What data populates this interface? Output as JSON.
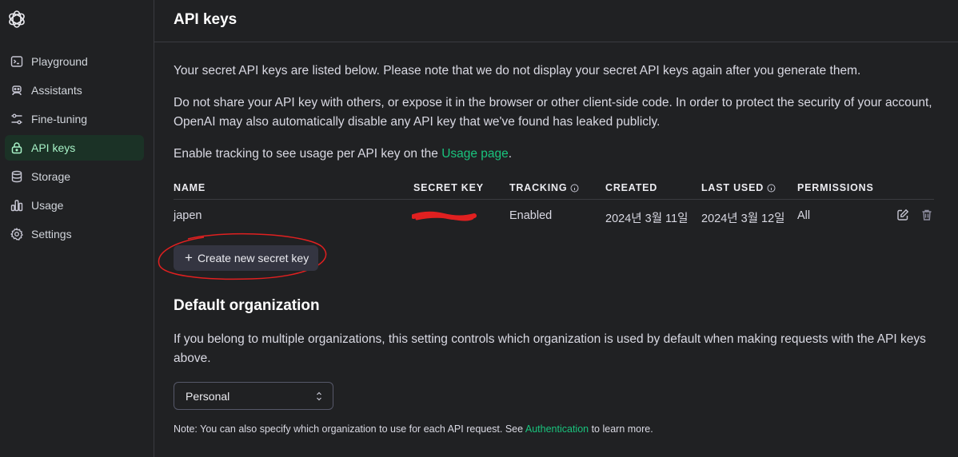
{
  "sidebar": {
    "logo": "openai-logo",
    "items": [
      {
        "label": "Playground",
        "icon": "terminal-icon"
      },
      {
        "label": "Assistants",
        "icon": "robot-icon"
      },
      {
        "label": "Fine-tuning",
        "icon": "sliders-icon"
      },
      {
        "label": "API keys",
        "icon": "lock-icon",
        "active": true
      },
      {
        "label": "Storage",
        "icon": "database-icon"
      },
      {
        "label": "Usage",
        "icon": "chart-icon"
      },
      {
        "label": "Settings",
        "icon": "gear-icon"
      }
    ]
  },
  "header": {
    "title": "API keys"
  },
  "intro": {
    "p1": "Your secret API keys are listed below. Please note that we do not display your secret API keys again after you generate them.",
    "p2": "Do not share your API key with others, or expose it in the browser or other client-side code. In order to protect the security of your account, OpenAI may also automatically disable any API key that we've found has leaked publicly.",
    "p3_before": "Enable tracking to see usage per API key on the ",
    "p3_link": "Usage page",
    "p3_after": "."
  },
  "table": {
    "columns": [
      "NAME",
      "SECRET KEY",
      "TRACKING",
      "CREATED",
      "LAST USED",
      "PERMISSIONS"
    ],
    "rows": [
      {
        "name": "japen",
        "secret_key": "sk-...redacted",
        "tracking": "Enabled",
        "created": "2024년 3월 11일",
        "last_used": "2024년 3월 12일",
        "permissions": "All"
      }
    ]
  },
  "create_button": "Create new secret key",
  "default_org": {
    "heading": "Default organization",
    "description": "If you belong to multiple organizations, this setting controls which organization is used by default when making requests with the API keys above.",
    "selected": "Personal"
  },
  "note": {
    "before": "Note: You can also specify which organization to use for each API request. See ",
    "link": "Authentication",
    "after": " to learn more."
  },
  "colors": {
    "accent": "#19c37d",
    "active_bg": "#1b3226",
    "annotation": "#e02020"
  }
}
